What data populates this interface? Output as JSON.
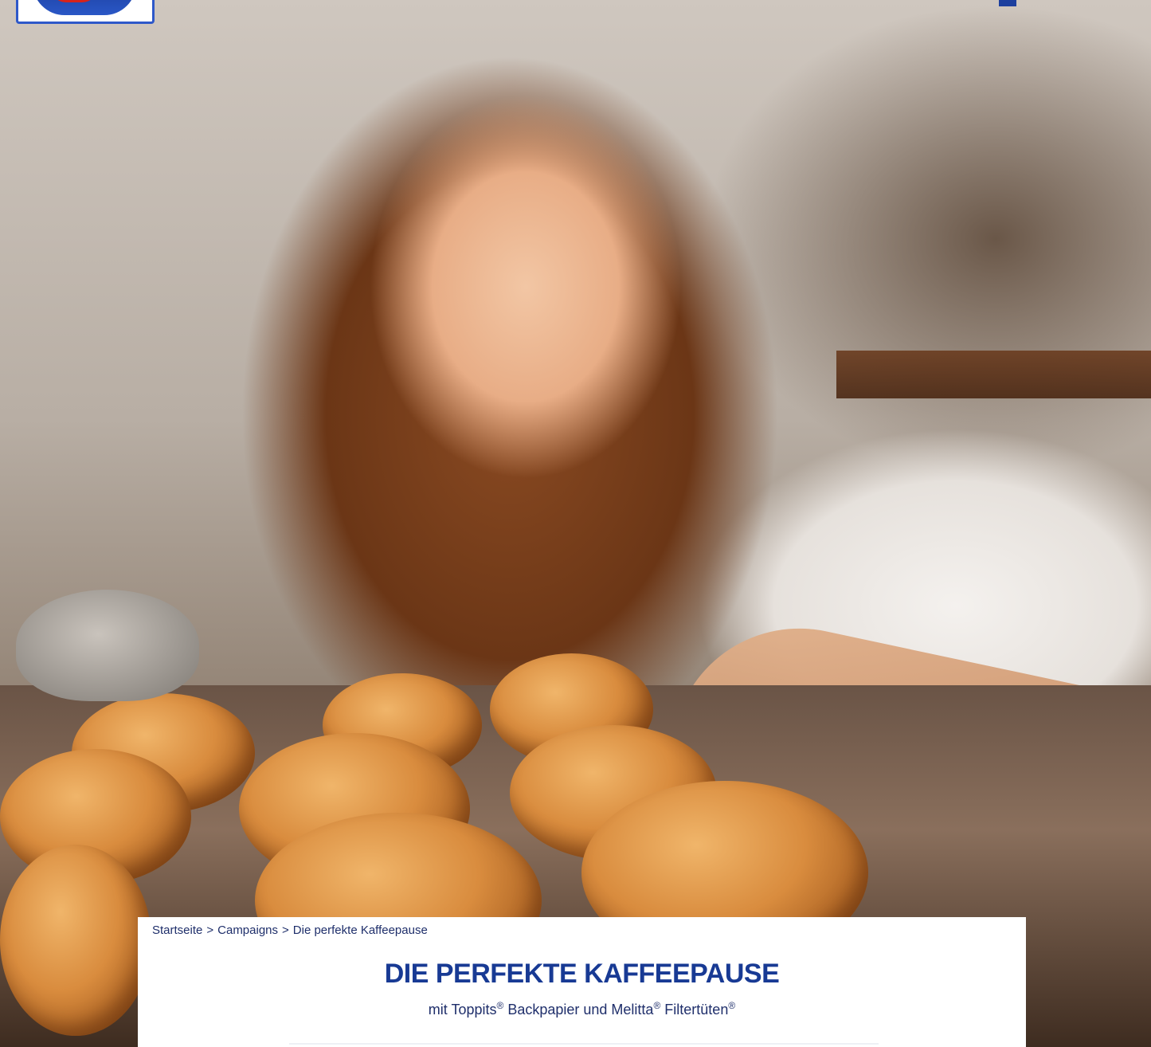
{
  "breadcrumb": {
    "items": [
      "Startseite",
      "Campaigns",
      "Die perfekte Kaffeepause"
    ],
    "separator": ">"
  },
  "hero": {
    "title": "DIE PERFEKTE KAFFEEPAUSE",
    "subtitle_parts": {
      "prefix": "mit Toppits",
      "reg1": "®",
      "middle": " Backpapier und Melitta",
      "reg2": "®",
      "middle2": " Filtertüten",
      "reg3": "®"
    }
  },
  "colors": {
    "title": "#183a94",
    "text": "#1f2f6b",
    "brand_blue": "#1c3f9e",
    "brand_red": "#d6231c"
  }
}
